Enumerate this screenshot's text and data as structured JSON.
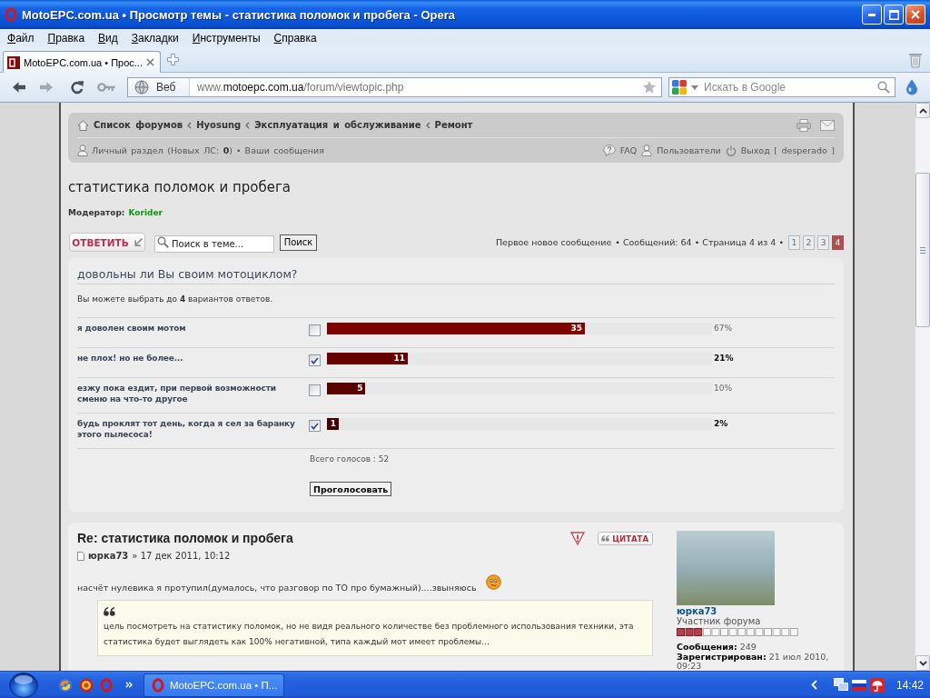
{
  "window": {
    "title": "MotoEPC.com.ua • Просмотр темы - статистика поломок и пробега - Opera"
  },
  "menu": [
    "Файл",
    "Правка",
    "Вид",
    "Закладки",
    "Инструменты",
    "Справка"
  ],
  "tabs": [
    {
      "label": "MotoEPC.com.ua • Прос...",
      "selected": true
    }
  ],
  "address_bar": {
    "mode": "Веб",
    "url": "www.**motoepc.com.ua**/forum/viewtopic.php"
  },
  "web_search": {
    "placeholder": "Искать в Google"
  },
  "navbar": {
    "breadcrumbs": [
      "Список форумов",
      "Hyosung",
      "Эксплуатация и обслуживание",
      "Ремонт"
    ],
    "left_links": [
      {
        "kind": "user_link",
        "text": "Личный раздел (Новых ЛС: **0**)"
      },
      {
        "kind": "separator",
        "text": "•"
      },
      {
        "kind": "link",
        "text": "Ваши сообщения"
      }
    ],
    "right_links": [
      "FAQ",
      "Пользователи",
      "Выход [ desperado ]"
    ]
  },
  "topic": {
    "title": "статистика поломок и пробега",
    "moderator_label": "Модератор:",
    "moderator": "Korider"
  },
  "actions": {
    "reply_button": "ОТВЕТИТЬ",
    "search_placeholder": "Поиск в теме...",
    "search_button": "Поиск",
    "first_unread": "Первое новое сообщение",
    "summary": "• Сообщений: 64 • Страница 4 из 4 •",
    "pages": [
      {
        "label": "1",
        "selected": false
      },
      {
        "label": "2",
        "selected": false
      },
      {
        "label": "3",
        "selected": false
      },
      {
        "label": "4",
        "selected": true
      }
    ]
  },
  "poll": {
    "question": "довольны ли Вы своим мотоциклом?",
    "note": "Вы можете выбрать до **4** вариантов ответов.",
    "options": [
      {
        "label": "я доволен своим мотом",
        "checked": false,
        "votes": "35",
        "level": 0.67,
        "percent": "67%",
        "color": "#800000"
      },
      {
        "label": "не плох! но не более...",
        "checked": true,
        "votes": "11",
        "level": 0.21,
        "percent": "21%",
        "color": "#680000"
      },
      {
        "label": "езжу пока ездит, при первой возможности сменю на что-то другое",
        "checked": false,
        "votes": "5",
        "level": 0.1,
        "percent": "10%",
        "color": "#5a0000"
      },
      {
        "label": "будь проклят тот день, когда я сел за баранку этого пылесоса!",
        "checked": true,
        "votes": "1",
        "level": 0.02,
        "percent": "2%",
        "color": "#4a0000"
      }
    ],
    "total": "Всего голосов : 52",
    "vote_button": "Проголосовать"
  },
  "post": {
    "title": "Re: статистика поломок и пробега",
    "author": "юрка73",
    "date": "» 17 дек 2011, 10:12",
    "quote_button": "ЦИТАТА",
    "text": "насчёт нулевика я протупил(думалось, что разговор по ТО про бумажный)....звыняюсь",
    "quote": "цель посмотреть на статистику поломок, но не видя реального количестве без проблемного использования техники, эта статистика будет выглядеть как 100% негативной, типа каждый мот имеет проблемы...",
    "profile": {
      "username": "юрка73",
      "rank": "Участник форума",
      "posts": "**Сообщения:** 249",
      "joined": "**Зарегистрирован:** 21 июл 2010, 09:23"
    }
  },
  "taskbar": {
    "task": "MotoEPC.com.ua • П...",
    "clock": "14:42"
  }
}
